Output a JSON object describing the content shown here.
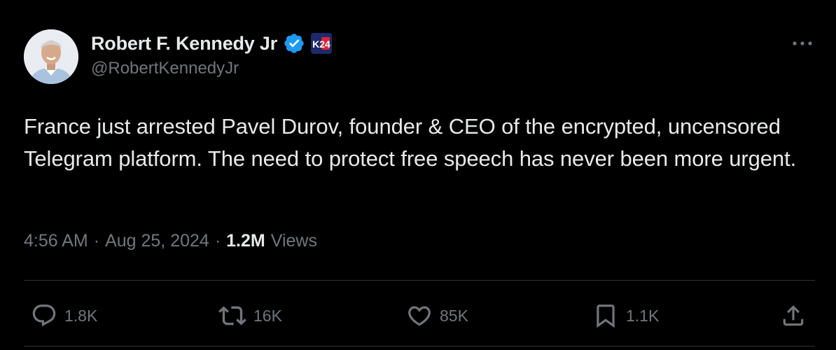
{
  "author": {
    "display_name": "Robert F. Kennedy Jr",
    "handle": "@RobertKennedyJr",
    "badge_text": "K24"
  },
  "tweet": {
    "text": "France just arrested Pavel Durov, founder & CEO of the encrypted, uncensored Telegram platform. The need to protect free speech has never been more urgent.",
    "time": "4:56 AM",
    "date": "Aug 25, 2024",
    "views_count": "1.2M",
    "views_label": "Views",
    "separator": "·"
  },
  "actions": {
    "replies": "1.8K",
    "reposts": "16K",
    "likes": "85K",
    "bookmarks": "1.1K"
  },
  "icons": {
    "verified": "verified-badge-icon",
    "more": "more-options-icon",
    "reply": "reply-icon",
    "repost": "repost-icon",
    "like": "heart-icon",
    "bookmark": "bookmark-icon",
    "share": "share-icon"
  },
  "colors": {
    "background": "#000000",
    "text_primary": "#e7e9ea",
    "text_secondary": "#71767b",
    "verified_blue": "#1d9bf0",
    "badge_navy": "#1b2a6b",
    "badge_red": "#d6263c",
    "divider": "#2f3336"
  }
}
